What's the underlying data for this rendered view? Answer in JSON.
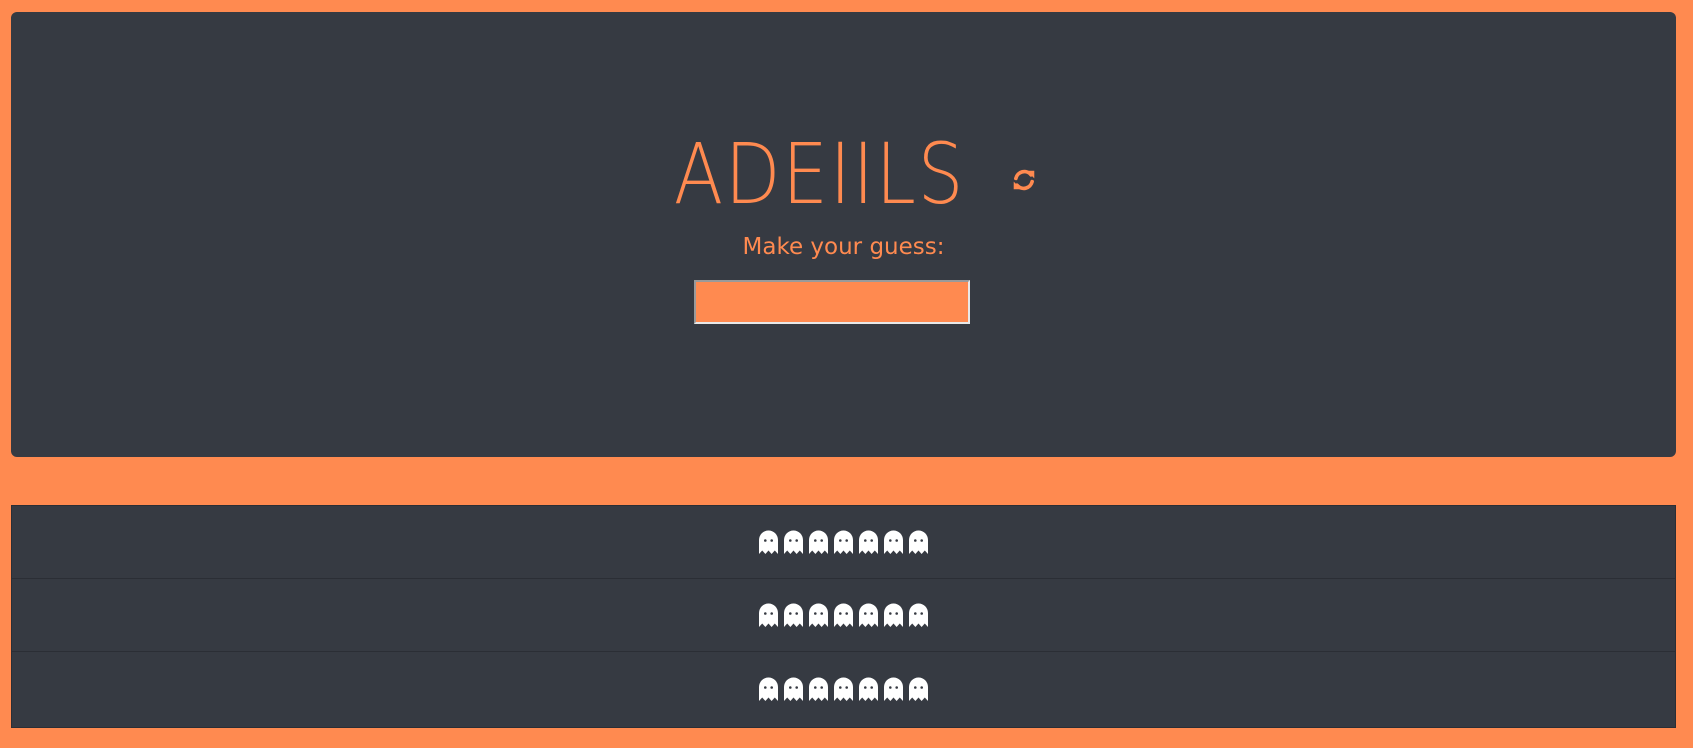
{
  "game": {
    "scrambled_word": "ADEIILS",
    "refresh_icon": "refresh-icon",
    "prompt": "Make your guess:",
    "guess_value": "",
    "guess_placeholder": ""
  },
  "answer_rows": [
    {
      "slots": 7,
      "slot_icon": "ghost-icon"
    },
    {
      "slots": 7,
      "slot_icon": "ghost-icon"
    },
    {
      "slots": 7,
      "slot_icon": "ghost-icon"
    }
  ],
  "colors": {
    "background": "#ff8a50",
    "panel": "#363a42",
    "accent": "#ff8a50",
    "ghost": "#ffffff"
  }
}
